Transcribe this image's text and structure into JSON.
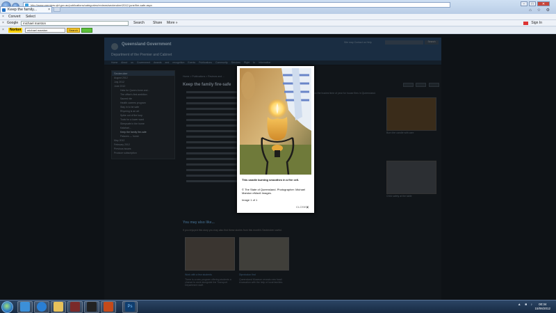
{
  "browser": {
    "address": "http://www.premiers.qld.gov.au/publications/categories/reviews/secteruber/2012-june/fire-safe.aspx",
    "tab_title": "Keep the family...",
    "controls": [
      "−",
      "□",
      "✕"
    ],
    "right_icons": "⌂ ☆ ⚙"
  },
  "toolbars": {
    "row1": {
      "convert": "Convert",
      "select": "Select"
    },
    "row2": {
      "google_label": "Google",
      "google_value": "michael marston",
      "search": "Search",
      "share": "Share",
      "more": "More »",
      "signin": "Sign In"
    },
    "row3": {
      "norton": "Norton",
      "norton_value": "michael marston",
      "norton_search": "Search"
    }
  },
  "site": {
    "title": "Queensland Government",
    "subtitle": "Department of the Premier and Cabinet",
    "links": "Site map   Contact us   Help",
    "search_btn": "Search",
    "nav": "Home  About us  Government  Awards and recognition  Events  Publications  Community Services  Right to information",
    "breadcrumb": "Home > Publications > Reviews and ...",
    "heading": "Keep the family fire-safe",
    "body_right": "as the busiest time of year for house fires in Queensland.",
    "sidebar_head": "Secteruber",
    "sidebar_items": [
      "August 2012",
      "July 2012",
      "June 2012",
      "Hats for Queen Anne and...",
      "The office's first ambition",
      "Sacred rite",
      "Health careers program",
      "Stay in to be safe",
      "Rhyming is an art",
      "Spike out of the loop",
      "Tools for a lower ward",
      "Sleepsafe in the home",
      "Kalahari...",
      "Keep the family fire-safe",
      "Palaces — home",
      "May 2012",
      "February 2012",
      "Previous issues",
      "Produce subscription"
    ],
    "more_title": "You may also like...",
    "more_sub": "If you enjoyed this story you may also find these stories from this month's Secteruber useful.",
    "cards": [
      {
        "title": "Work with a few students",
        "text": "There is a new program offering students a chance to work alongside the Transport Department staff."
      },
      {
        "title": "Diprotodon find",
        "text": "Queensland Museum reveals new fossil excavation with the help of local families."
      }
    ],
    "thumb_caps": [
      "Burn the candle with care",
      "Child safety at the table"
    ]
  },
  "lightbox": {
    "caption": "This candle burning smoothes in a fire cell.",
    "copyright": "© The State of Queensland. Photographer: Michael Marston eMax6 Images.",
    "page": "Image 1 of 1",
    "close": "CLOSE"
  },
  "taskbar": {
    "tray": "▲ ■ ♪",
    "time": "00:34",
    "date": "15/06/2012"
  }
}
